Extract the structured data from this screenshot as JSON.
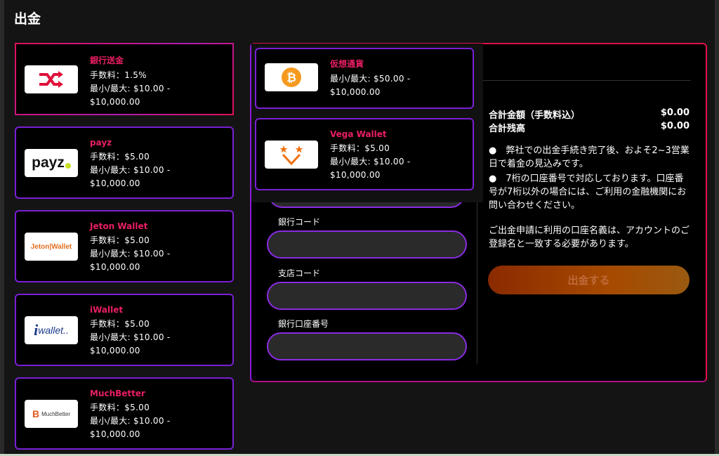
{
  "page": {
    "title": "出金"
  },
  "methods": [
    {
      "name": "銀行送金",
      "fee": "手数料：1.5%",
      "limits": "最小/最大: $10.00 -",
      "limits_max": "$10,000.00",
      "logo": "shuffle-arrows-icon"
    },
    {
      "name": "payz",
      "fee": "手数料：$5.00",
      "limits": "最小/最大: $10.00 -",
      "limits_max": "$10,000.00",
      "logo": "payz"
    },
    {
      "name": "Jeton Wallet",
      "fee": "手数料：$5.00",
      "limits": "最小/最大: $10.00 -",
      "limits_max": "$10,000.00",
      "logo": "Jeton|Wallet"
    },
    {
      "name": "iWallet",
      "fee": "手数料：$5.00",
      "limits": "最小/最大: $10.00 -",
      "limits_max": "$10,000.00",
      "logo": "wallet.."
    },
    {
      "name": "MuchBetter",
      "fee": "手数料：$5.00",
      "limits": "最小/最大: $10.00 -",
      "limits_max": "$10,000.00",
      "logo": "MuchBetter"
    }
  ],
  "dropdown": [
    {
      "name": "仮想通貨",
      "limits": "最小/最大: $50.00 -",
      "limits_max": "$10,000.00",
      "logo": "bitcoin-icon"
    },
    {
      "name": "Vega Wallet",
      "fee": "手数料：$5.00",
      "limits": "最小/最大: $10.00 -",
      "limits_max": "$10,000.00",
      "logo": "vega-wallet-icon"
    }
  ],
  "form": {
    "bank_code_label": "銀行コード",
    "branch_code_label": "支店コード",
    "account_number_label": "銀行口座番号",
    "bank_code_value": "",
    "branch_code_value": "",
    "account_number_value": ""
  },
  "summary": {
    "total_label": "合計金額（手数料込）",
    "total_value": "$0.00",
    "balance_label": "合計残高",
    "balance_value": "$0.00",
    "note1": "●　弊社での出金手続き完了後、およそ2~3営業日で着金の見込みです。",
    "note2": "●　7桁の口座番号で対応しております。口座番号が7桁以外の場合には、ご利用の金融機関にお問い合わせください。",
    "note3": "ご出金申請に利用の口座名義は、アカウントのご登録名と一致する必要があります。",
    "submit_label": "出金する"
  },
  "colors": {
    "accent_pink": "#e91e63",
    "border_purple": "#7a1fd6",
    "panel_red": "#e0104a"
  }
}
